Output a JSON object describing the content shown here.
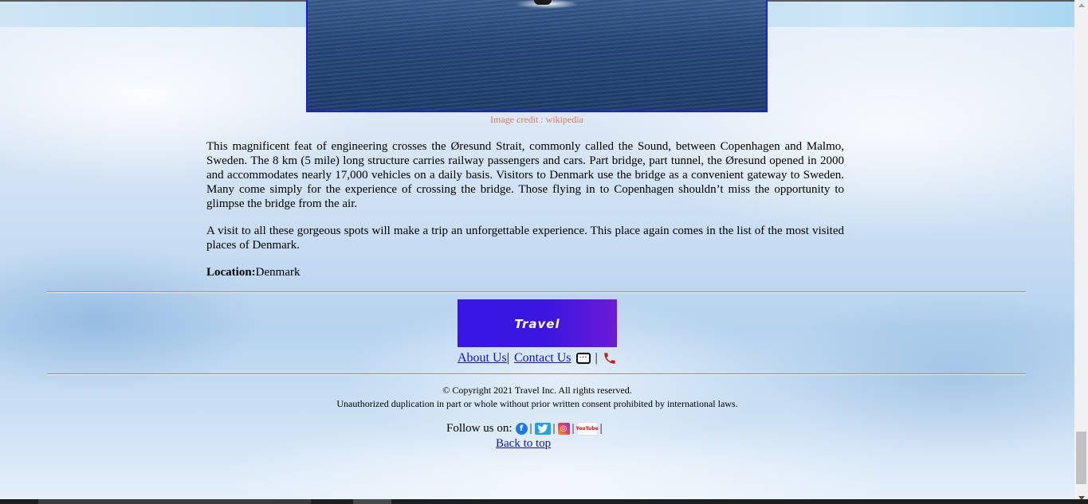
{
  "image": {
    "caption": "Image credit : wikipedia"
  },
  "article": {
    "paragraphs": [
      "This magnificent feat of engineering crosses the Øresund Strait, commonly called the Sound, between Copenhagen and Malmo, Sweden. The 8 km (5 mile) long structure carries railway passengers and cars. Part bridge, part tunnel, the Øresund opened in 2000 and accommodates nearly 17,000 vehicles on a daily basis. Visitors to Denmark use the bridge as a convenient gateway to Sweden. Many come simply for the experience of crossing the bridge. Those flying in to Copenhagen shouldn’t miss the opportunity to glimpse the bridge from the air.",
      "A visit to all these gorgeous spots will make a trip an unforgettable experience. This place again comes in the list of the most visited places of Denmark."
    ],
    "location_label": "Location:",
    "location_value": "Denmark"
  },
  "footer": {
    "logo_text": "Travel",
    "about_label": "About Us",
    "contact_label": "Contact Us",
    "separator": "|",
    "copyright": "© Copyright 2021 Travel Inc. All rights reserved.",
    "disclaimer": "Unauthorized duplication in part or whole without prior written consent prohibited by international laws.",
    "follow_label": "Follow us on:",
    "social_icons": [
      "facebook-icon",
      "twitter-icon",
      "instagram-icon",
      "youtube-icon"
    ],
    "youtube_text": "YouTube",
    "back_to_top": "Back to top"
  },
  "colors": {
    "link": "#1111cc",
    "caption": "#e07a5a",
    "image_border": "#1e1ee0",
    "logo_bg": "#3a16e6"
  }
}
